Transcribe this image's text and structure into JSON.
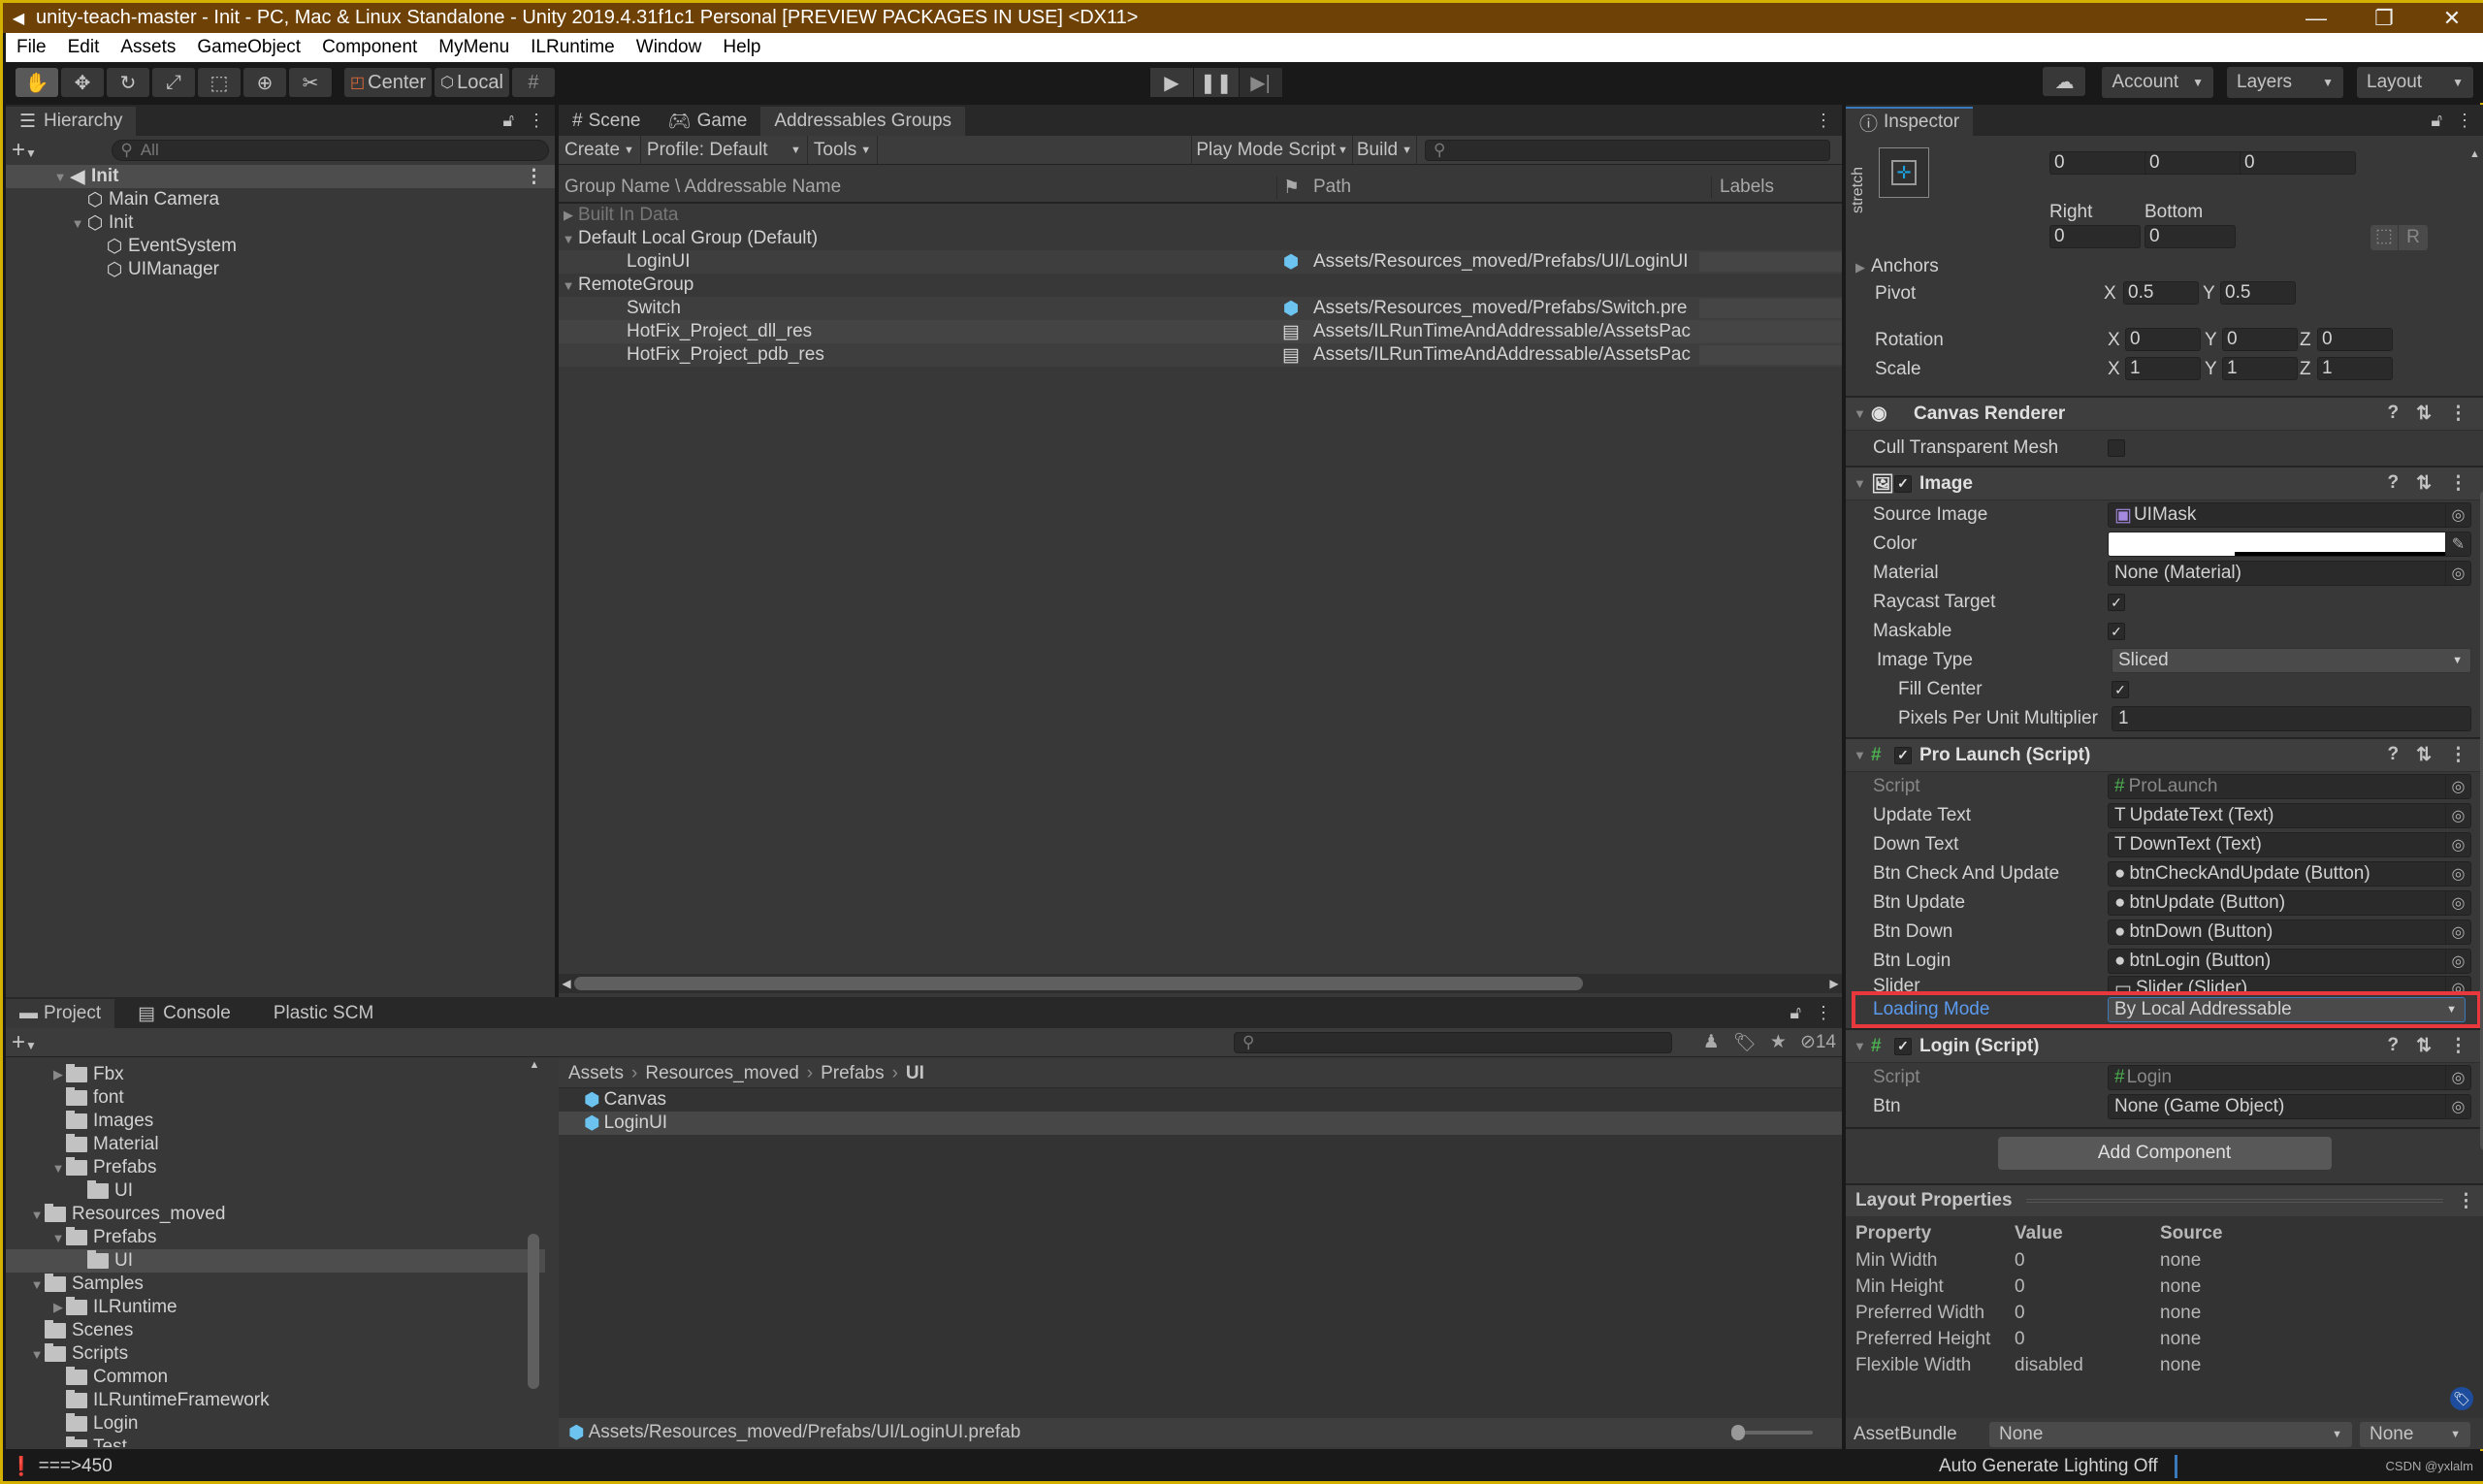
{
  "window": {
    "title": "unity-teach-master - Init - PC, Mac & Linux Standalone - Unity 2019.4.31f1c1 Personal [PREVIEW PACKAGES IN USE] <DX11>",
    "minimize": "—",
    "restore": "❐",
    "close": "✕"
  },
  "menu": [
    "File",
    "Edit",
    "Assets",
    "GameObject",
    "Component",
    "MyMenu",
    "ILRuntime",
    "Window",
    "Help"
  ],
  "toolbar": {
    "tools": [
      "hand-tool",
      "move-tool",
      "rotate-tool",
      "scale-tool",
      "rect-tool",
      "transform-tool",
      "custom-tool"
    ],
    "pivot_mode": "Center",
    "pivot_rotation": "Local",
    "account": "Account",
    "layers": "Layers",
    "layout": "Layout"
  },
  "hierarchy": {
    "tab": "Hierarchy",
    "search_placeholder": "All",
    "items": [
      {
        "label": "Init",
        "depth": 0,
        "expanded": true,
        "scene": true
      },
      {
        "label": "Main Camera",
        "depth": 1
      },
      {
        "label": "Init",
        "depth": 1,
        "expanded": true
      },
      {
        "label": "EventSystem",
        "depth": 2
      },
      {
        "label": "UIManager",
        "depth": 2
      }
    ]
  },
  "center": {
    "tabs": [
      "Scene",
      "Game",
      "Addressables Groups"
    ],
    "active_tab": "Addressables Groups",
    "toolbar": {
      "create": "Create",
      "profile": "Profile: Default",
      "tools": "Tools",
      "play_mode_script": "Play Mode Script",
      "build": "Build"
    },
    "columns": {
      "name": "Group Name \\ Addressable Name",
      "path": "Path",
      "labels": "Labels"
    },
    "groups": [
      {
        "name": "Built In Data",
        "expanded": false,
        "disabled": true,
        "entries": []
      },
      {
        "name": "Default Local Group (Default)",
        "expanded": true,
        "entries": [
          {
            "name": "LoginUI",
            "icon": "prefab",
            "path": "Assets/Resources_moved/Prefabs/UI/LoginUI"
          }
        ]
      },
      {
        "name": "RemoteGroup",
        "expanded": true,
        "entries": [
          {
            "name": "Switch",
            "icon": "prefab",
            "path": "Assets/Resources_moved/Prefabs/Switch.pre"
          },
          {
            "name": "HotFix_Project_dll_res",
            "icon": "file",
            "path": "Assets/ILRunTimeAndAddressable/AssetsPac"
          },
          {
            "name": "HotFix_Project_pdb_res",
            "icon": "file",
            "path": "Assets/ILRunTimeAndAddressable/AssetsPac"
          }
        ]
      }
    ]
  },
  "project": {
    "tabs": [
      "Project",
      "Console",
      "Plastic SCM"
    ],
    "tree": [
      {
        "label": "Fbx",
        "depth": 1,
        "arrow": "right"
      },
      {
        "label": "font",
        "depth": 1
      },
      {
        "label": "Images",
        "depth": 1
      },
      {
        "label": "Material",
        "depth": 1
      },
      {
        "label": "Prefabs",
        "depth": 1,
        "arrow": "down",
        "open": true
      },
      {
        "label": "UI",
        "depth": 2
      },
      {
        "label": "Resources_moved",
        "depth": 0,
        "arrow": "down",
        "open": true
      },
      {
        "label": "Prefabs",
        "depth": 1,
        "arrow": "down",
        "open": true
      },
      {
        "label": "UI",
        "depth": 2,
        "selected": true
      },
      {
        "label": "Samples",
        "depth": 0,
        "arrow": "down",
        "open": true
      },
      {
        "label": "ILRuntime",
        "depth": 1,
        "arrow": "right"
      },
      {
        "label": "Scenes",
        "depth": 0
      },
      {
        "label": "Scripts",
        "depth": 0,
        "arrow": "down",
        "open": true
      },
      {
        "label": "Common",
        "depth": 1
      },
      {
        "label": "ILRuntimeFramework",
        "depth": 1
      },
      {
        "label": "Login",
        "depth": 1
      },
      {
        "label": "Test",
        "depth": 1
      }
    ],
    "breadcrumb": [
      "Assets",
      "Resources_moved",
      "Prefabs",
      "UI"
    ],
    "files": [
      {
        "name": "Canvas"
      },
      {
        "name": "LoginUI",
        "selected": true
      }
    ],
    "hidden_count": "14",
    "selected_path": "Assets/Resources_moved/Prefabs/UI/LoginUI.prefab"
  },
  "inspector": {
    "tab": "Inspector",
    "rect": {
      "anchor_label": "stretch",
      "top_values": [
        "0",
        "0",
        "0"
      ],
      "right_label": "Right",
      "bottom_label": "Bottom",
      "right": "0",
      "bottom": "0",
      "raw_btn": "R",
      "anchors": "Anchors",
      "pivot_label": "Pivot",
      "pivot_x": "0.5",
      "pivot_y": "0.5",
      "rotation_label": "Rotation",
      "rotation": [
        "0",
        "0",
        "0"
      ],
      "scale_label": "Scale",
      "scale": [
        "1",
        "1",
        "1"
      ]
    },
    "canvas_renderer": {
      "title": "Canvas Renderer",
      "cull_label": "Cull Transparent Mesh",
      "cull": false
    },
    "image": {
      "title": "Image",
      "source_image_label": "Source Image",
      "source_image": "UIMask",
      "color_label": "Color",
      "color": "#ffffff",
      "material_label": "Material",
      "material": "None (Material)",
      "raycast_label": "Raycast Target",
      "maskable_label": "Maskable",
      "image_type_label": "Image Type",
      "image_type": "Sliced",
      "fill_center_label": "Fill Center",
      "ppu_label": "Pixels Per Unit Multiplier",
      "ppu": "1"
    },
    "pro_launch": {
      "title": "Pro Launch (Script)",
      "fields": [
        {
          "label": "Script",
          "value": "ProLaunch",
          "icon": "#",
          "dim": true
        },
        {
          "label": "Update Text",
          "value": "UpdateText (Text)",
          "icon": "T"
        },
        {
          "label": "Down Text",
          "value": "DownText (Text)",
          "icon": "T"
        },
        {
          "label": "Btn Check And Update",
          "value": "btnCheckAndUpdate (Button)",
          "icon": "●"
        },
        {
          "label": "Btn Update",
          "value": "btnUpdate (Button)",
          "icon": "●"
        },
        {
          "label": "Btn Down",
          "value": "btnDown (Button)",
          "icon": "●"
        },
        {
          "label": "Btn Login",
          "value": "btnLogin (Button)",
          "icon": "●"
        },
        {
          "label": "Slider",
          "value": "Slider (Slider)",
          "icon": "▭"
        }
      ],
      "loading_mode_label": "Loading Mode",
      "loading_mode": "By Local Addressable"
    },
    "login": {
      "title": "Login (Script)",
      "script_label": "Script",
      "script": "Login",
      "btn_label": "Btn",
      "btn": "None (Game Object)"
    },
    "add_component": "Add Component",
    "layout_properties": {
      "title": "Layout Properties",
      "headers": [
        "Property",
        "Value",
        "Source"
      ],
      "rows": [
        [
          "Min Width",
          "0",
          "none"
        ],
        [
          "Min Height",
          "0",
          "none"
        ],
        [
          "Preferred Width",
          "0",
          "none"
        ],
        [
          "Preferred Height",
          "0",
          "none"
        ],
        [
          "Flexible Width",
          "disabled",
          "none"
        ]
      ]
    },
    "assetbundle_label": "AssetBundle",
    "assetbundle": "None",
    "assetbundle_variant": "None"
  },
  "status": {
    "message": "===>450",
    "lighting": "Auto Generate Lighting Off",
    "watermark": "CSDN @yxlalm"
  },
  "colors": {
    "title_bar": "#6e4107",
    "highlight_box": "#e8383d",
    "accent_blue": "#3a79bb",
    "prefab_blue": "#6cc3f0"
  }
}
